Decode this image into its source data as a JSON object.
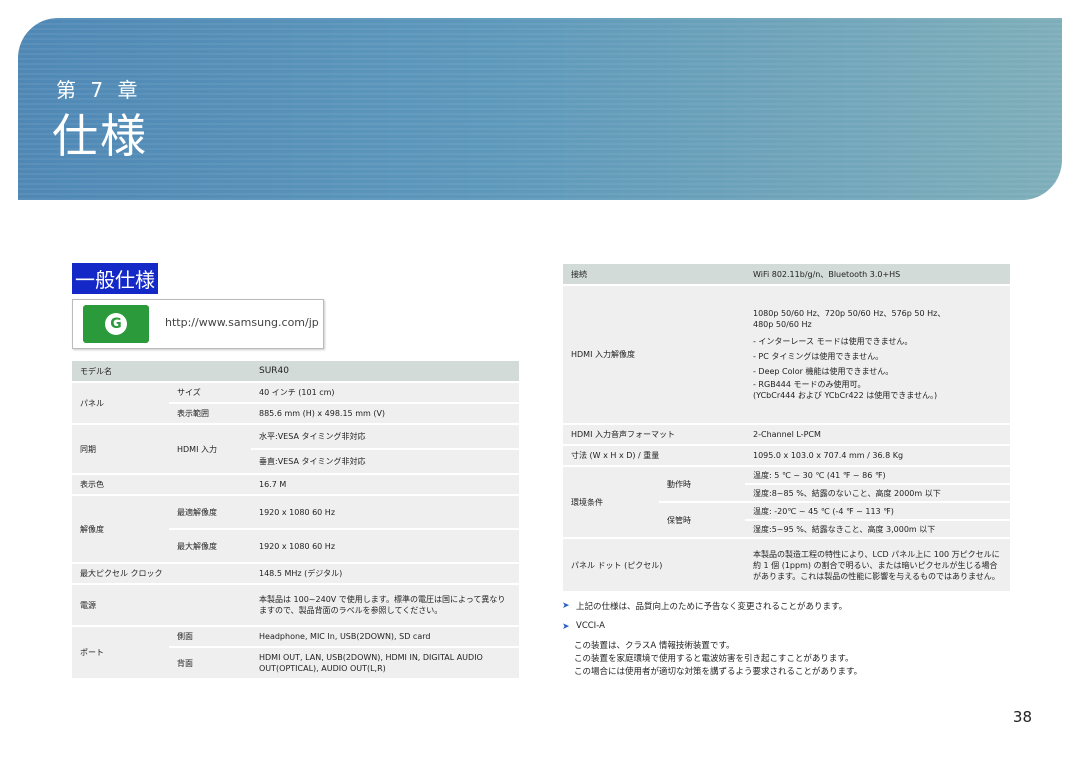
{
  "header": {
    "chapter": "第 7 章",
    "title": "仕様"
  },
  "section_title": "一般仕様",
  "logo": {
    "url": "http://www.samsung.com/jp"
  },
  "left_table": {
    "model_label": "モデル名",
    "model_value": "SUR40",
    "panel": {
      "label": "パネル",
      "size_label": "サイズ",
      "size_value": "40 インチ (101 cm)",
      "area_label": "表示範囲",
      "area_value": "885.6 mm (H) x 498.15 mm (V)"
    },
    "sync": {
      "label": "同期",
      "sub_label": "HDMI 入力",
      "value1": "水平:VESA タイミング非対応",
      "value2": "垂直:VESA タイミング非対応"
    },
    "colors": {
      "label": "表示色",
      "value": "16.7 M"
    },
    "resolution": {
      "label": "解像度",
      "opt_label": "最適解像度",
      "opt_value": "1920 x 1080 60 Hz",
      "max_label": "最大解像度",
      "max_value": "1920 x 1080 60 Hz"
    },
    "clock": {
      "label": "最大ピクセル クロック",
      "value": "148.5 MHz (デジタル)"
    },
    "power": {
      "label": "電源",
      "value": "本製品は 100~240V で使用します。標準の電圧は国によって異なりますので、製品背面のラベルを参照してください。"
    },
    "ports": {
      "label": "ポート",
      "side_label": "側面",
      "side_value": "Headphone, MIC In, USB(2DOWN), SD card",
      "back_label": "背面",
      "back_value": "HDMI OUT, LAN, USB(2DOWN), HDMI IN, DIGITAL AUDIO OUT(OPTICAL), AUDIO OUT(L,R)"
    }
  },
  "right_table": {
    "connection": {
      "label": "接続",
      "value": "WiFi 802.11b/g/n、Bluetooth 3.0+HS"
    },
    "hdmi_res": {
      "label": "HDMI 入力解像度",
      "lines": [
        "1080p 50/60 Hz、720p 50/60 Hz、576p 50 Hz、",
        "480p 50/60 Hz",
        "- インターレース モードは使用できません。",
        "- PC タイミングは使用できません。",
        "- Deep Color 機能は使用できません。",
        "- RGB444 モードのみ使用可。",
        "(YCbCr444 および YCbCr422 は使用できません。)"
      ]
    },
    "hdmi_audio": {
      "label": "HDMI 入力音声フォーマット",
      "value": "2-Channel L-PCM"
    },
    "dimensions": {
      "label": "寸法 (W x H x D) / 重量",
      "value": "1095.0 x 103.0 x 707.4 mm / 36.8 Kg"
    },
    "environment": {
      "label": "環境条件",
      "op_label": "動作時",
      "op_temp": "温度: 5 ℃ ~ 30 ℃ (41 ℉ ~ 86 ℉)",
      "op_humidity": "湿度:8~85 %、結露のないこと、高度 2000m 以下",
      "st_label": "保管時",
      "st_temp": "温度: -20℃ ~ 45 ℃ (-4 ℉ ~ 113 ℉)",
      "st_humidity": "湿度:5~95 %、結露なきこと、高度 3,000m 以下"
    },
    "pixel": {
      "label": "パネル ドット (ピクセル)",
      "value": "本製品の製造工程の特性により、LCD パネル上に 100 万ピクセルに約 1 個 (1ppm) の割合で明るい、または暗いピクセルが生じる場合があります。これは製品の性能に影響を与えるものではありません。"
    }
  },
  "notes": {
    "note1": "上記の仕様は、品質向上のために予告なく変更されることがあります。",
    "note2": "VCCI-A",
    "vcci_lines": [
      "この装置は、クラスA 情報技術装置です。",
      "この装置を家庭環境で使用すると電波妨害を引き起こすことがあります。",
      "この場合には使用者が適切な対策を講ずるよう要求されることがあります。"
    ]
  },
  "page_number": "38"
}
